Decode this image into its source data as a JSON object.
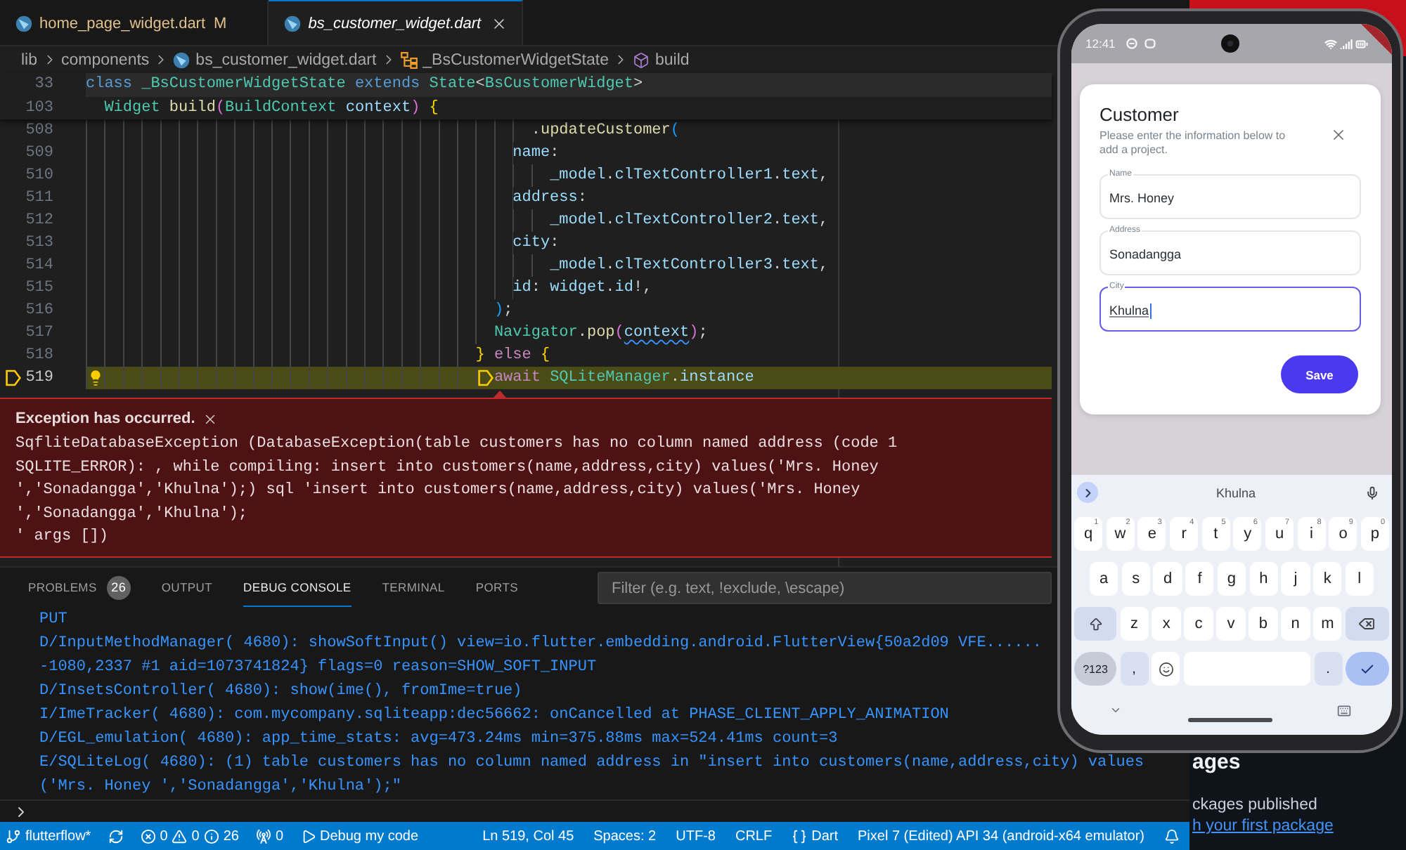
{
  "editor_tabs": [
    {
      "label": "home_page_widget.dart",
      "status": "M",
      "modified": true,
      "preview": false,
      "selected": false
    },
    {
      "label": "bs_customer_widget.dart",
      "modified": false,
      "preview": true,
      "selected": true
    }
  ],
  "breadcrumb": [
    {
      "label": "lib",
      "kind": "folder"
    },
    {
      "label": "components",
      "kind": "folder"
    },
    {
      "label": "bs_customer_widget.dart",
      "kind": "file"
    },
    {
      "label": "_BsCustomerWidgetState",
      "kind": "class"
    },
    {
      "label": "build",
      "kind": "method"
    }
  ],
  "sticky_scroll": [
    {
      "number": "33",
      "hovered": true,
      "tokens": [
        {
          "text": "class ",
          "kind": "keyword"
        },
        {
          "text": "_BsCustomerWidgetState ",
          "kind": "type"
        },
        {
          "text": "extends ",
          "kind": "keyword"
        },
        {
          "text": "State",
          "kind": "type"
        },
        {
          "text": "<",
          "kind": "plain"
        },
        {
          "text": "BsCustomerWidget",
          "kind": "type"
        },
        {
          "text": ">",
          "kind": "plain"
        }
      ]
    },
    {
      "number": "103",
      "hovered": false,
      "tokens": [
        {
          "text": "  Widget ",
          "kind": "type"
        },
        {
          "text": "build",
          "kind": "function"
        },
        {
          "text": "(",
          "kind": "bracket2"
        },
        {
          "text": "BuildContext ",
          "kind": "type"
        },
        {
          "text": "context",
          "kind": "variable"
        },
        {
          "text": ")",
          "kind": "bracket2"
        },
        {
          "text": " {",
          "kind": "bracket1"
        }
      ]
    }
  ],
  "code_lines": [
    {
      "number": "508",
      "current": false,
      "lightbulb": false,
      "tokens": [
        {
          "text": "                                                .",
          "kind": "plain"
        },
        {
          "text": "updateCustomer",
          "kind": "function"
        },
        {
          "text": "(",
          "kind": "bracket3"
        }
      ]
    },
    {
      "number": "509",
      "current": false,
      "lightbulb": false,
      "tokens": [
        {
          "text": "                                              name",
          "kind": "variable"
        },
        {
          "text": ":",
          "kind": "plain"
        }
      ]
    },
    {
      "number": "510",
      "current": false,
      "lightbulb": false,
      "tokens": [
        {
          "text": "                                                  _model",
          "kind": "variable"
        },
        {
          "text": ".",
          "kind": "plain"
        },
        {
          "text": "clTextController1",
          "kind": "variable"
        },
        {
          "text": ".",
          "kind": "plain"
        },
        {
          "text": "text",
          "kind": "variable"
        },
        {
          "text": ",",
          "kind": "plain"
        }
      ]
    },
    {
      "number": "511",
      "current": false,
      "lightbulb": false,
      "tokens": [
        {
          "text": "                                              address",
          "kind": "variable"
        },
        {
          "text": ":",
          "kind": "plain"
        }
      ]
    },
    {
      "number": "512",
      "current": false,
      "lightbulb": false,
      "tokens": [
        {
          "text": "                                                  _model",
          "kind": "variable"
        },
        {
          "text": ".",
          "kind": "plain"
        },
        {
          "text": "clTextController2",
          "kind": "variable"
        },
        {
          "text": ".",
          "kind": "plain"
        },
        {
          "text": "text",
          "kind": "variable"
        },
        {
          "text": ",",
          "kind": "plain"
        }
      ]
    },
    {
      "number": "513",
      "current": false,
      "lightbulb": false,
      "tokens": [
        {
          "text": "                                              city",
          "kind": "variable"
        },
        {
          "text": ":",
          "kind": "plain"
        }
      ]
    },
    {
      "number": "514",
      "current": false,
      "lightbulb": false,
      "tokens": [
        {
          "text": "                                                  _model",
          "kind": "variable"
        },
        {
          "text": ".",
          "kind": "plain"
        },
        {
          "text": "clTextController3",
          "kind": "variable"
        },
        {
          "text": ".",
          "kind": "plain"
        },
        {
          "text": "text",
          "kind": "variable"
        },
        {
          "text": ",",
          "kind": "plain"
        }
      ]
    },
    {
      "number": "515",
      "current": false,
      "lightbulb": false,
      "tokens": [
        {
          "text": "                                              id",
          "kind": "variable"
        },
        {
          "text": ": ",
          "kind": "plain"
        },
        {
          "text": "widget",
          "kind": "variable"
        },
        {
          "text": ".",
          "kind": "plain"
        },
        {
          "text": "id",
          "kind": "variable"
        },
        {
          "text": "!,",
          "kind": "plain"
        }
      ]
    },
    {
      "number": "516",
      "current": false,
      "lightbulb": false,
      "tokens": [
        {
          "text": "                                            )",
          "kind": "bracket3"
        },
        {
          "text": ";",
          "kind": "plain"
        }
      ]
    },
    {
      "number": "517",
      "current": false,
      "lightbulb": false,
      "tokens": [
        {
          "text": "                                            Navigator",
          "kind": "type"
        },
        {
          "text": ".",
          "kind": "plain"
        },
        {
          "text": "pop",
          "kind": "function"
        },
        {
          "text": "(",
          "kind": "bracket2"
        },
        {
          "text": "context",
          "kind": "variable_info"
        },
        {
          "text": ")",
          "kind": "bracket2"
        },
        {
          "text": ";",
          "kind": "plain"
        }
      ]
    },
    {
      "number": "518",
      "current": false,
      "lightbulb": false,
      "tokens": [
        {
          "text": "                                          }",
          "kind": "bracket1"
        },
        {
          "text": " else ",
          "kind": "control"
        },
        {
          "text": "{",
          "kind": "bracket1"
        }
      ]
    },
    {
      "number": "519",
      "current": true,
      "lightbulb": true,
      "tokens": [
        {
          "text": "                                            await ",
          "kind": "control"
        },
        {
          "text": "SQLiteManager",
          "kind": "type"
        },
        {
          "text": ".",
          "kind": "plain"
        },
        {
          "text": "instance",
          "kind": "variable"
        }
      ]
    }
  ],
  "exception": {
    "title": "Exception has occurred.",
    "message": "SqfliteDatabaseException (DatabaseException(table customers has no column named address (code 1\nSQLITE_ERROR): , while compiling: insert into customers(name,address,city) values('Mrs. Honey\n','Sonadangga','Khulna');) sql 'insert into customers(name,address,city) values('Mrs. Honey\n','Sonadangga','Khulna');\n' args [])"
  },
  "panel": {
    "tabs": [
      {
        "label": "PROBLEMS",
        "badge": "26",
        "selected": false
      },
      {
        "label": "OUTPUT",
        "selected": false
      },
      {
        "label": "DEBUG CONSOLE",
        "selected": true
      },
      {
        "label": "TERMINAL",
        "selected": false
      },
      {
        "label": "PORTS",
        "selected": false
      }
    ],
    "filter": {
      "placeholder": "Filter (e.g. text, !exclude, \\escape)"
    },
    "console_lines": [
      "PUT",
      "D/InputMethodManager( 4680): showSoftInput() view=io.flutter.embedding.android.FlutterView{50a2d09 VFE......",
      "-1080,2337 #1 aid=1073741824} flags=0 reason=SHOW_SOFT_INPUT",
      "D/InsetsController( 4680): show(ime(), fromIme=true)",
      "I/ImeTracker( 4680): com.mycompany.sqliteapp:dec56662: onCancelled at PHASE_CLIENT_APPLY_ANIMATION",
      "D/EGL_emulation( 4680): app_time_stats: avg=473.24ms min=375.88ms max=524.41ms count=3",
      "E/SQLiteLog( 4680): (1) table customers has no column named address in \"insert into customers(name,address,city) values",
      "('Mrs. Honey ','Sonadangga','Khulna');\""
    ]
  },
  "status_bar": {
    "left": [
      {
        "kind": "branch",
        "text": "flutterflow*"
      },
      {
        "kind": "sync"
      },
      {
        "kind": "problems",
        "errors": "0",
        "warnings": "0",
        "infos": "26"
      },
      {
        "kind": "ports",
        "text": "0"
      },
      {
        "kind": "debug",
        "text": "Debug my code"
      }
    ],
    "right": [
      {
        "kind": "position",
        "text": "Ln 519, Col 45"
      },
      {
        "kind": "plain",
        "text": "Spaces: 2"
      },
      {
        "kind": "plain",
        "text": "UTF-8"
      },
      {
        "kind": "plain",
        "text": "CRLF"
      },
      {
        "kind": "language",
        "text": "Dart"
      },
      {
        "kind": "plain",
        "text": "Pixel 7 (Edited) API 34 (android-x64 emulator)"
      },
      {
        "kind": "notifications"
      }
    ]
  },
  "phone": {
    "status_bar": {
      "time": "12:41"
    },
    "dialog": {
      "title": "Customer",
      "subtitle": "Please enter the information below to add a project.",
      "fields": [
        {
          "label": "Name",
          "value": "Mrs. Honey",
          "focused": false
        },
        {
          "label": "Address",
          "value": "Sonadangga",
          "focused": false
        },
        {
          "label": "City",
          "value": "Khulna",
          "focused": true
        }
      ],
      "button": "Save"
    },
    "keyboard": {
      "suggestion": "Khulna",
      "rows": [
        {
          "kind": "full",
          "keys": [
            {
              "kind": "letter",
              "label": "q",
              "hint": "1"
            },
            {
              "kind": "letter",
              "label": "w",
              "hint": "2"
            },
            {
              "kind": "letter",
              "label": "e",
              "hint": "3"
            },
            {
              "kind": "letter",
              "label": "r",
              "hint": "4"
            },
            {
              "kind": "letter",
              "label": "t",
              "hint": "5"
            },
            {
              "kind": "letter",
              "label": "y",
              "hint": "6"
            },
            {
              "kind": "letter",
              "label": "u",
              "hint": "7"
            },
            {
              "kind": "letter",
              "label": "i",
              "hint": "8"
            },
            {
              "kind": "letter",
              "label": "o",
              "hint": "9"
            },
            {
              "kind": "letter",
              "label": "p",
              "hint": "0"
            }
          ]
        },
        {
          "kind": "inset",
          "keys": [
            {
              "kind": "letter",
              "label": "a"
            },
            {
              "kind": "letter",
              "label": "s"
            },
            {
              "kind": "letter",
              "label": "d"
            },
            {
              "kind": "letter",
              "label": "f"
            },
            {
              "kind": "letter",
              "label": "g"
            },
            {
              "kind": "letter",
              "label": "h"
            },
            {
              "kind": "letter",
              "label": "j"
            },
            {
              "kind": "letter",
              "label": "k"
            },
            {
              "kind": "letter",
              "label": "l"
            }
          ]
        },
        {
          "kind": "full",
          "keys": [
            {
              "kind": "shift"
            },
            {
              "kind": "letter",
              "label": "z"
            },
            {
              "kind": "letter",
              "label": "x"
            },
            {
              "kind": "letter",
              "label": "c"
            },
            {
              "kind": "letter",
              "label": "v"
            },
            {
              "kind": "letter",
              "label": "b"
            },
            {
              "kind": "letter",
              "label": "n"
            },
            {
              "kind": "letter",
              "label": "m"
            },
            {
              "kind": "backspace"
            }
          ]
        },
        {
          "kind": "full",
          "keys": [
            {
              "kind": "symbols",
              "label": "?123"
            },
            {
              "kind": "punct",
              "label": ","
            },
            {
              "kind": "emoji"
            },
            {
              "kind": "space"
            },
            {
              "kind": "punct",
              "label": "."
            },
            {
              "kind": "enter"
            }
          ]
        }
      ]
    }
  },
  "background_page": {
    "heading": "ages",
    "text": "ckages published",
    "link": "h your first package"
  }
}
